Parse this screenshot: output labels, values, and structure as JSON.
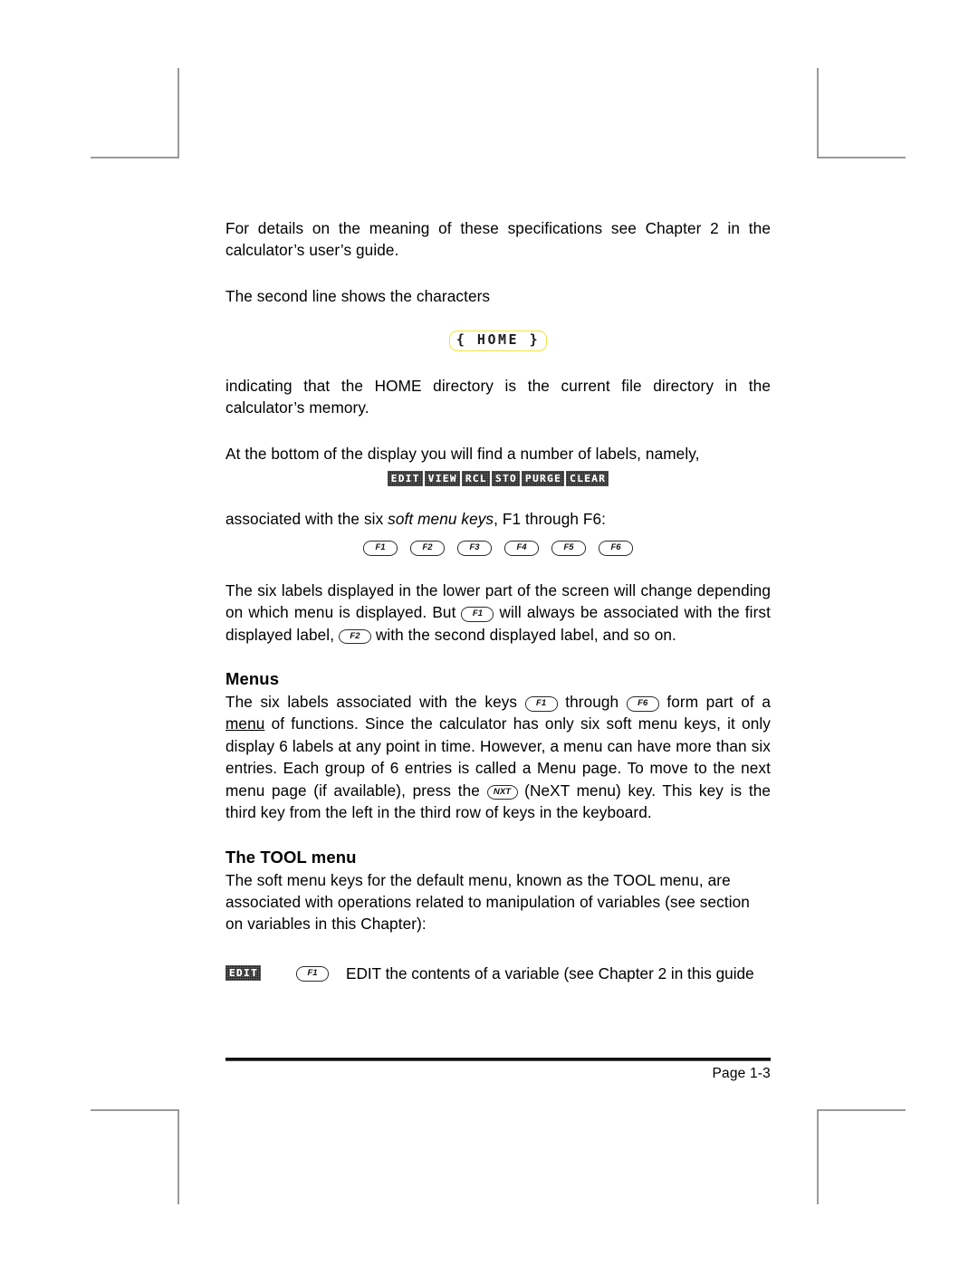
{
  "document": {
    "page_label": "Page 1-3"
  },
  "paragraphs": {
    "p1": "For details on the meaning of these specifications see Chapter 2 in the calculator’s user’s guide.",
    "p2": "The second line shows the characters",
    "p3": "indicating that the HOME directory is the current file directory in the calculator’s memory.",
    "p4": "At the bottom of the display you will find a number of labels, namely,",
    "p5_a": "associated with the six ",
    "p5_italic": "soft menu keys",
    "p5_b": ", F1 through F6:",
    "p6_a": "The six labels displayed in the lower part of the screen will change depending on which menu is displayed.  But ",
    "p6_b": " will always be associated with the first displayed label, ",
    "p6_c": " with the second displayed label, and so on."
  },
  "home_display": {
    "text": "{ HOME }",
    "border_color": "#f2e53a"
  },
  "soft_menu": {
    "labels": [
      "EDIT",
      "VIEW",
      "RCL",
      "STO",
      "PURGE",
      "CLEAR"
    ]
  },
  "function_keys": {
    "keys": [
      "F1",
      "F2",
      "F3",
      "F4",
      "F5",
      "F6"
    ]
  },
  "inline_keys": {
    "f1": "F1",
    "f2": "F2",
    "f6": "F6",
    "nxt": "NXT"
  },
  "sections": {
    "menus": {
      "heading": "Menus",
      "para_a": "The six labels associated with the keys ",
      "para_b": " through ",
      "para_c": " form part of a ",
      "para_underlined": "menu",
      "para_d": " of functions.  Since the calculator has only six soft menu keys, it only display 6 labels at any point in time.  However, a menu can have more than six entries.  Each group of 6 entries is called a Menu page.   To move to the next menu page (if available), press the ",
      "para_e": " (NeXT menu) key.  This key is the third key from the left in the third row of keys in the keyboard."
    },
    "tool": {
      "heading": "The TOOL menu",
      "para": "The soft menu keys for the default menu, known as the TOOL menu, are associated with operations related to manipulation of variables (see section on variables in this Chapter):",
      "entry": {
        "label": "EDIT",
        "key": "F1",
        "description": "EDIT the contents of a variable (see Chapter 2 in this guide"
      }
    }
  }
}
